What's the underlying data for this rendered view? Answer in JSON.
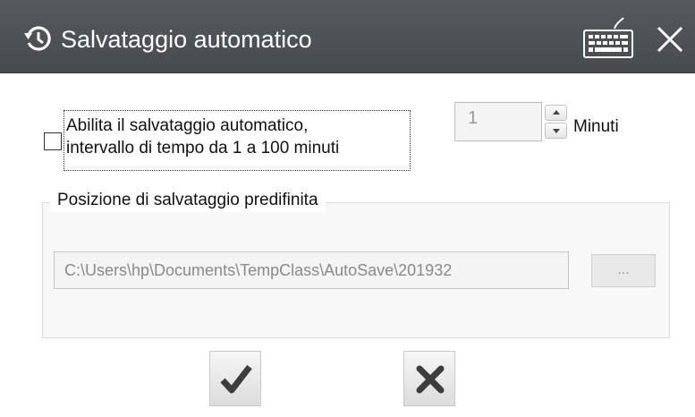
{
  "window": {
    "title": "Salvataggio automatico",
    "title_icon": "history-icon",
    "keyboard_icon": "keyboard-icon",
    "close_icon": "close-icon"
  },
  "autosave": {
    "checkbox_checked": false,
    "label_line1": "Abilita il salvataggio automatico,",
    "label_line2": "intervallo di tempo da 1 a 100  minuti",
    "interval_value": "1",
    "unit_label": "Minuti"
  },
  "default_location": {
    "group_title": "Posizione di salvataggio predifinita",
    "path_value": "C:\\Users\\hp\\Documents\\TempClass\\AutoSave\\201932",
    "browse_label": "..."
  },
  "buttons": {
    "ok_icon": "checkmark-icon",
    "cancel_icon": "x-icon"
  },
  "colors": {
    "titlebar": "#4d5155",
    "text": "#111111",
    "disabled_text": "#8a8a8a"
  }
}
